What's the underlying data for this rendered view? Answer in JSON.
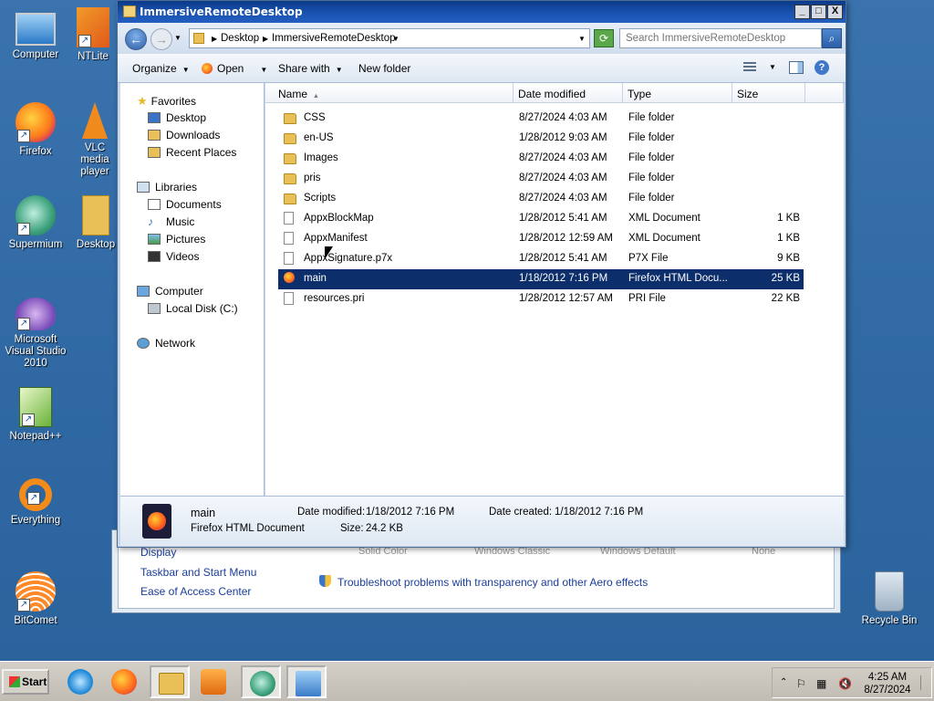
{
  "desktop": {
    "icons": [
      {
        "label": "Computer"
      },
      {
        "label": "NTLite"
      },
      {
        "label": "Firefox"
      },
      {
        "label": "VLC media player"
      },
      {
        "label": "Supermium"
      },
      {
        "label": "Desktop"
      },
      {
        "label": "Microsoft Visual Studio 2010"
      },
      {
        "label": "Notepad++"
      },
      {
        "label": "Everything"
      },
      {
        "label": "BitComet"
      },
      {
        "label": "Recycle Bin"
      }
    ]
  },
  "background_window": {
    "links": [
      "Display",
      "Taskbar and Start Menu",
      "Ease of Access Center"
    ],
    "troubleshoot": "Troubleshoot problems with transparency and other Aero effects",
    "faded": [
      "Solid Color",
      "Windows Classic",
      "Windows Default",
      "None"
    ]
  },
  "window": {
    "title": "ImmersiveRemoteDesktop",
    "controls": {
      "minimize": "_",
      "maximize": "□",
      "close": "X"
    }
  },
  "address": {
    "crumbs": [
      "Desktop",
      "ImmersiveRemoteDesktop"
    ],
    "search_placeholder": "Search ImmersiveRemoteDesktop"
  },
  "toolbar": {
    "organize": "Organize",
    "open": "Open",
    "share_with": "Share with",
    "new_folder": "New folder"
  },
  "nav": {
    "favorites": "Favorites",
    "favorites_items": [
      "Desktop",
      "Downloads",
      "Recent Places"
    ],
    "libraries": "Libraries",
    "libraries_items": [
      "Documents",
      "Music",
      "Pictures",
      "Videos"
    ],
    "computer": "Computer",
    "computer_items": [
      "Local Disk (C:)"
    ],
    "network": "Network"
  },
  "columns": {
    "name": "Name",
    "date": "Date modified",
    "type": "Type",
    "size": "Size"
  },
  "files": [
    {
      "name": "CSS",
      "date": "8/27/2024 4:03 AM",
      "type": "File folder",
      "size": "",
      "kind": "folder"
    },
    {
      "name": "en-US",
      "date": "1/28/2012 9:03 AM",
      "type": "File folder",
      "size": "",
      "kind": "folder"
    },
    {
      "name": "Images",
      "date": "8/27/2024 4:03 AM",
      "type": "File folder",
      "size": "",
      "kind": "folder"
    },
    {
      "name": "pris",
      "date": "8/27/2024 4:03 AM",
      "type": "File folder",
      "size": "",
      "kind": "folder"
    },
    {
      "name": "Scripts",
      "date": "8/27/2024 4:03 AM",
      "type": "File folder",
      "size": "",
      "kind": "folder"
    },
    {
      "name": "AppxBlockMap",
      "date": "1/28/2012 5:41 AM",
      "type": "XML Document",
      "size": "1 KB",
      "kind": "xml"
    },
    {
      "name": "AppxManifest",
      "date": "1/28/2012 12:59 AM",
      "type": "XML Document",
      "size": "1 KB",
      "kind": "xml"
    },
    {
      "name": "AppxSignature.p7x",
      "date": "1/28/2012 5:41 AM",
      "type": "P7X File",
      "size": "9 KB",
      "kind": "doc"
    },
    {
      "name": "main",
      "date": "1/18/2012 7:16 PM",
      "type": "Firefox HTML Docu...",
      "size": "25 KB",
      "kind": "html",
      "selected": true
    },
    {
      "name": "resources.pri",
      "date": "1/28/2012 12:57 AM",
      "type": "PRI File",
      "size": "22 KB",
      "kind": "doc"
    }
  ],
  "details": {
    "name": "main",
    "type": "Firefox HTML Document",
    "modified_label": "Date modified:",
    "modified": "1/18/2012 7:16 PM",
    "created_label": "Date created:",
    "created": "1/18/2012 7:16 PM",
    "size_label": "Size:",
    "size": "24.2 KB"
  },
  "taskbar": {
    "start": "Start",
    "time": "4:25 AM",
    "date": "8/27/2024"
  }
}
